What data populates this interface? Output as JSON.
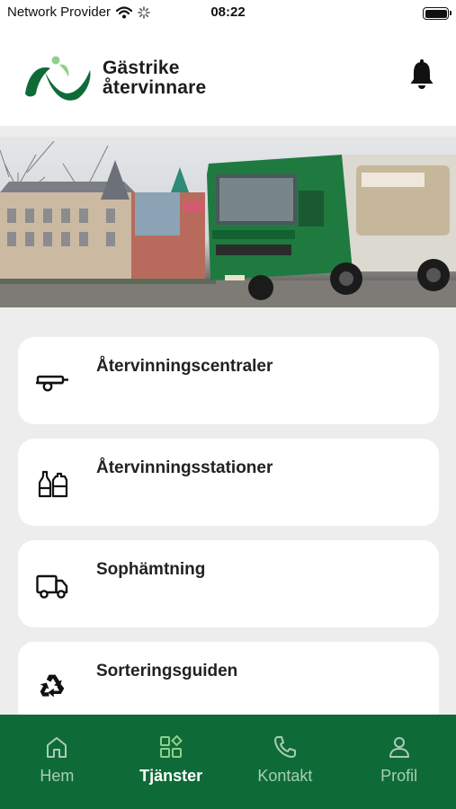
{
  "status_bar": {
    "carrier": "Network Provider",
    "time": "08:22",
    "icons": [
      "wifi-icon",
      "activity-spinner-icon",
      "battery-icon"
    ]
  },
  "header": {
    "brand_line1": "Gästrike",
    "brand_line2": "återvinnare",
    "notification_icon": "bell-icon",
    "brand_color": "#0e6b38"
  },
  "hero": {
    "image": "garbage-truck-city-photo"
  },
  "services": [
    {
      "label": "Återvinningscentraler",
      "icon": "trailer-icon"
    },
    {
      "label": "Återvinningsstationer",
      "icon": "bottles-icon"
    },
    {
      "label": "Sophämtning",
      "icon": "truck-icon"
    },
    {
      "label": "Sorteringsguiden",
      "icon": "recycle-icon"
    }
  ],
  "bottom_nav": {
    "items": [
      {
        "label": "Hem",
        "icon": "home-icon",
        "active": false
      },
      {
        "label": "Tjänster",
        "icon": "grid-icon",
        "active": true
      },
      {
        "label": "Kontakt",
        "icon": "phone-icon",
        "active": false
      },
      {
        "label": "Profil",
        "icon": "user-icon",
        "active": false
      }
    ],
    "background": "#0e6b38",
    "active_icon_color": "#8fd08a"
  }
}
